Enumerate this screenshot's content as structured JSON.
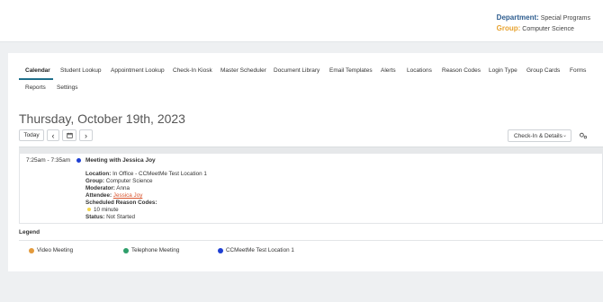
{
  "header": {
    "department_label": "Department:",
    "department_value": "Special Programs",
    "group_label": "Group:",
    "group_value": "Computer Science"
  },
  "tabs": [
    {
      "label": "Calendar",
      "active": true
    },
    {
      "label": "Student Lookup"
    },
    {
      "label": "Appointment Lookup"
    },
    {
      "label": "Check-In Kiosk"
    },
    {
      "label": "Master Scheduler"
    },
    {
      "label": "Document Library"
    },
    {
      "label": "Email Templates"
    },
    {
      "label": "Alerts"
    },
    {
      "label": "Locations"
    },
    {
      "label": "Reason Codes"
    },
    {
      "label": "Login Type"
    },
    {
      "label": "Group Cards"
    },
    {
      "label": "Forms"
    },
    {
      "label": "Reports"
    },
    {
      "label": "Settings"
    }
  ],
  "calendar": {
    "date_title": "Thursday, October 19th, 2023",
    "today_label": "Today",
    "prev_glyph": "‹",
    "next_glyph": "›",
    "view_select": "Check-In & Details"
  },
  "event": {
    "time": "7:25am - 7:35am",
    "title": "Meeting with Jessica Joy",
    "location_label": "Location:",
    "location_value": "In Office - CCMeetMe Test Location 1",
    "group_label": "Group:",
    "group_value": "Computer Science",
    "moderator_label": "Moderator:",
    "moderator_value": "Anna",
    "attendee_label": "Attendee:",
    "attendee_value": "Jessica Joy",
    "reason_label": "Scheduled Reason Codes:",
    "reason_value": "10 minute",
    "status_label": "Status:",
    "status_value": "Not Started",
    "dot_color": "#1e3fd3",
    "reason_color": "#f3d44a"
  },
  "legend": {
    "title": "Legend",
    "items": [
      {
        "label": "Video Meeting",
        "color": "#e39a3b"
      },
      {
        "label": "Telephone Meeting",
        "color": "#2e9e6a"
      },
      {
        "label": "CCMeetMe Test Location 1",
        "color": "#1e3fd3"
      }
    ]
  },
  "colors": {
    "accent": "#1f6f8b",
    "department": "#2e5d8f",
    "group": "#e7a22f",
    "link": "#d9532c"
  }
}
